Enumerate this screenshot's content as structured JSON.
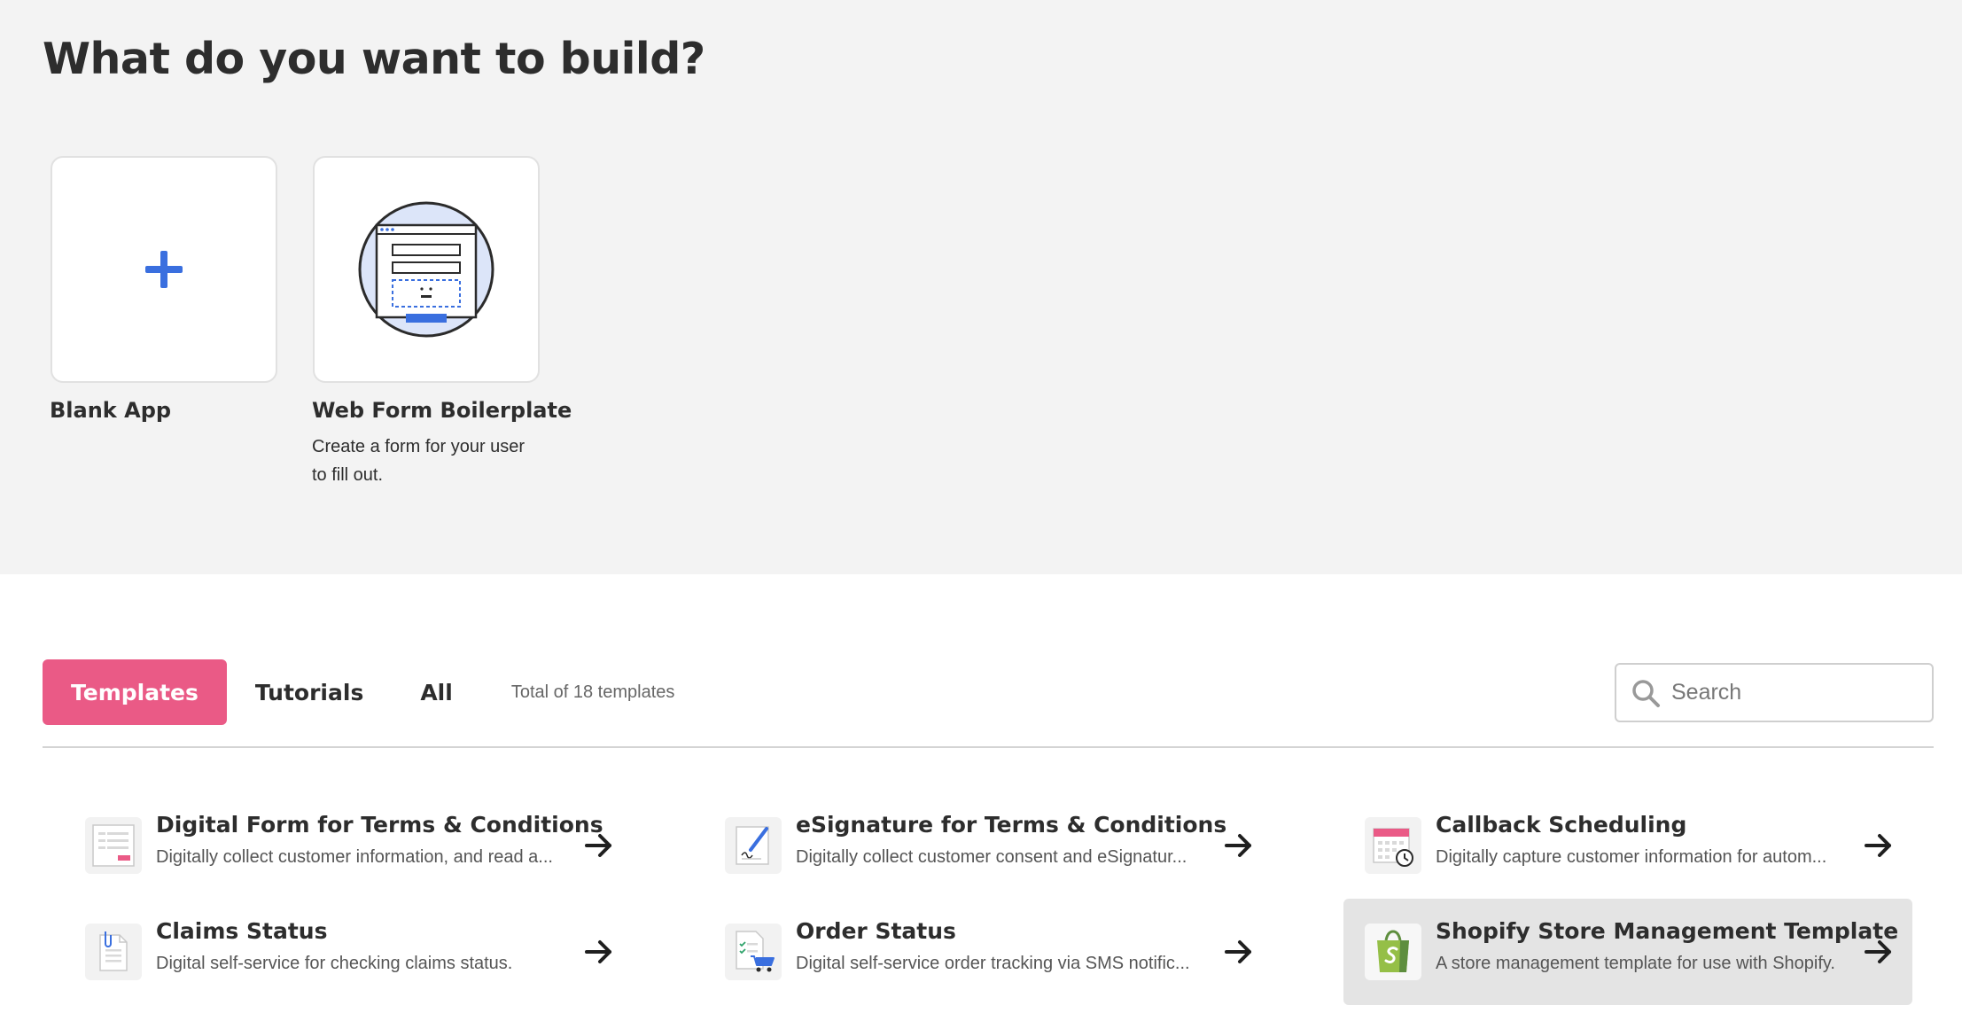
{
  "header": {
    "title": "What do you want to build?"
  },
  "starters": [
    {
      "label": "Blank App",
      "description": ""
    },
    {
      "label": "Web Form Boilerplate",
      "description_line1": "Create a form for your user",
      "description_line2": "to fill out."
    }
  ],
  "tabs": [
    {
      "label": "Templates",
      "active": true
    },
    {
      "label": "Tutorials",
      "active": false
    },
    {
      "label": "All",
      "active": false
    }
  ],
  "total_label": "Total of 18 templates",
  "search": {
    "placeholder": "Search",
    "value": ""
  },
  "templates": [
    {
      "name": "Digital Form for Terms & Conditions",
      "description": "Digitally collect customer information, and read a...",
      "icon": "form-document-icon"
    },
    {
      "name": "eSignature for Terms & Conditions",
      "description": "Digitally collect customer consent and eSignatur...",
      "icon": "signature-pen-icon"
    },
    {
      "name": "Callback Scheduling",
      "description": "Digitally capture customer information for autom...",
      "icon": "calendar-clock-icon"
    },
    {
      "name": "Claims Status",
      "description": "Digital self-service for checking claims status.",
      "icon": "clipboard-document-icon"
    },
    {
      "name": "Order Status",
      "description": "Digital self-service order tracking via SMS notific...",
      "icon": "order-cart-icon"
    },
    {
      "name": "Shopify Store Management Template",
      "description": "A store management template for use with Shopify.",
      "icon": "shopify-bag-icon"
    }
  ],
  "colors": {
    "accent_pink": "#ea5a86",
    "accent_blue": "#3a6fdf",
    "background_gray": "#f3f3f3"
  }
}
